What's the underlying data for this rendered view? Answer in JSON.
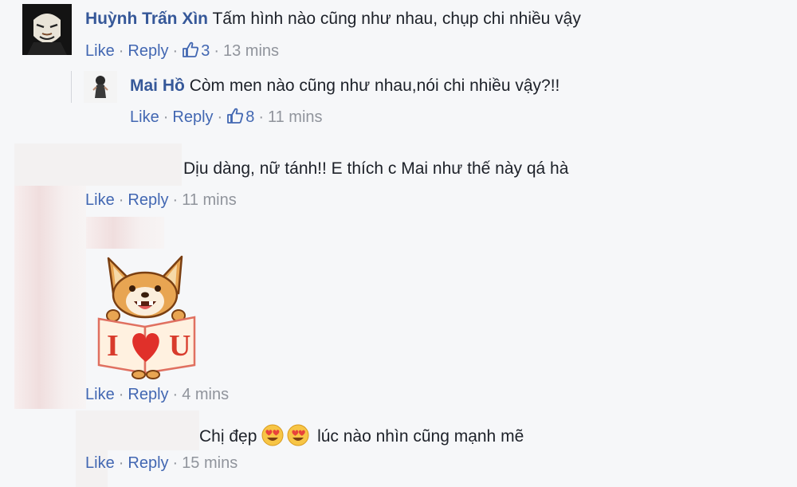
{
  "comments": [
    {
      "author": "Huỳnh Trấn Xìn",
      "text": "Tấm hình nào cũng như nhau, chụp chi nhiều vậy",
      "like": "Like",
      "reply": "Reply",
      "likes": "3",
      "time": "13 mins"
    },
    {
      "author": "Mai Hồ",
      "text": "Còm men nào cũng như nhau,nói chi nhiều vậy?!!",
      "like": "Like",
      "reply": "Reply",
      "likes": "8",
      "time": "11 mins"
    },
    {
      "author": "",
      "text": "Dịu dàng, nữ tánh!! E thích c Mai như thế này qá hà",
      "like": "Like",
      "reply": "Reply",
      "time": "11 mins"
    },
    {
      "author": "",
      "sticker": "corgi-i-love-u-sticker",
      "sticker_text_left": "I",
      "sticker_text_right": "U",
      "like": "Like",
      "reply": "Reply",
      "time": "4 mins"
    },
    {
      "author": "",
      "text_before": "Chị đẹp",
      "emoji": "heart-eyes-emoji",
      "text_after": "lúc nào nhìn cũng mạnh mẽ",
      "like": "Like",
      "reply": "Reply",
      "time": "15 mins"
    }
  ],
  "icons": {
    "like": "thumbs-up-icon"
  },
  "colors": {
    "link": "#4267b2",
    "author": "#365899",
    "meta": "#90949c"
  }
}
